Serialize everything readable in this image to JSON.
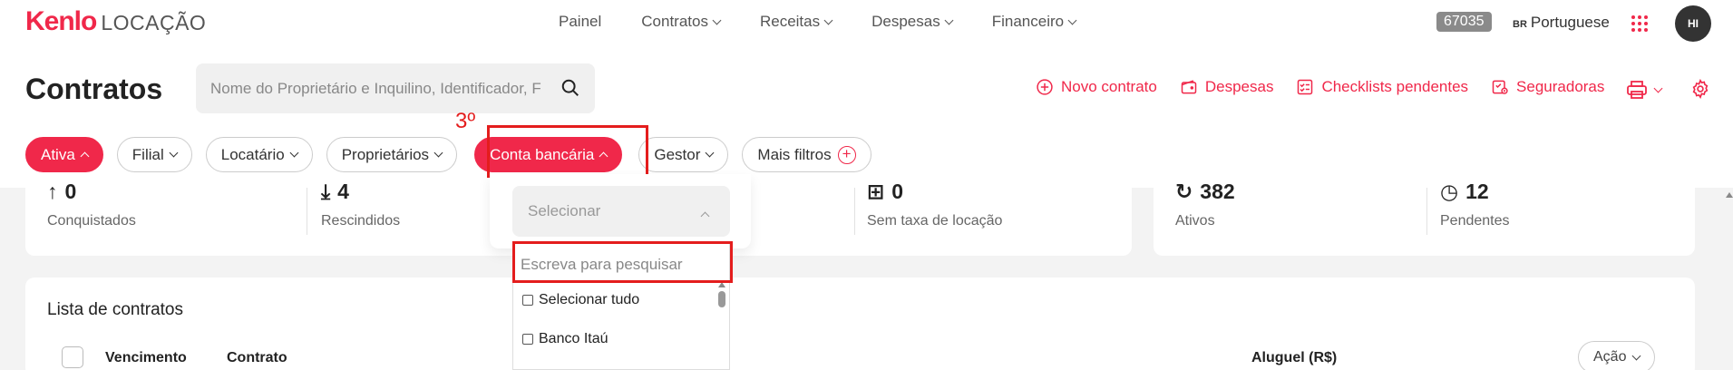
{
  "app": {
    "brand": "Kenlo",
    "product": "LOCAÇÃO"
  },
  "nav": [
    {
      "label": "Painel",
      "has_menu": false
    },
    {
      "label": "Contratos",
      "has_menu": true
    },
    {
      "label": "Receitas",
      "has_menu": true
    },
    {
      "label": "Despesas",
      "has_menu": true
    },
    {
      "label": "Financeiro",
      "has_menu": true
    }
  ],
  "account": {
    "code": "67035",
    "lang_code": "BR",
    "language": "Portuguese",
    "avatar_initials": "HI"
  },
  "page": {
    "title": "Contratos"
  },
  "search": {
    "placeholder": "Nome do Proprietário e Inquilino, Identificador, F"
  },
  "actions": {
    "novo_contrato": "Novo contrato",
    "despesas": "Despesas",
    "checklists": "Checklists pendentes",
    "seguradoras": "Seguradoras"
  },
  "filters": [
    {
      "label": "Ativa",
      "active": true,
      "expanded": true
    },
    {
      "label": "Filial",
      "active": false
    },
    {
      "label": "Locatário",
      "active": false
    },
    {
      "label": "Proprietários",
      "active": false
    },
    {
      "label": "Conta bancária",
      "active": true,
      "expanded": true
    },
    {
      "label": "Gestor",
      "active": false
    },
    {
      "label": "Mais filtros",
      "active": false
    }
  ],
  "annotation": {
    "step": "3º"
  },
  "stats_left": [
    {
      "value": "0",
      "label": "Conquistados",
      "icon": "arrow-up-icon"
    },
    {
      "value": "4",
      "label": "Rescindidos",
      "icon": "download-icon"
    },
    {
      "value": "0",
      "label": "Sem taxa de locação",
      "icon": "no-fee-icon"
    }
  ],
  "stats_right": [
    {
      "value": "382",
      "label": "Ativos",
      "icon": "refresh-icon"
    },
    {
      "value": "12",
      "label": "Pendentes",
      "icon": "clock-icon"
    }
  ],
  "contracts_list": {
    "title": "Lista de contratos",
    "columns": [
      "Vencimento",
      "Contrato",
      "Aluguel (R$)"
    ],
    "action_label": "Ação"
  },
  "bank_dropdown": {
    "select_placeholder": "Selecionar",
    "search_placeholder": "Escreva para pesquisar",
    "options": [
      "Selecionar tudo",
      "Banco Itaú"
    ]
  },
  "colors": {
    "accent": "#f0284a",
    "annotation": "#e41d1d"
  }
}
